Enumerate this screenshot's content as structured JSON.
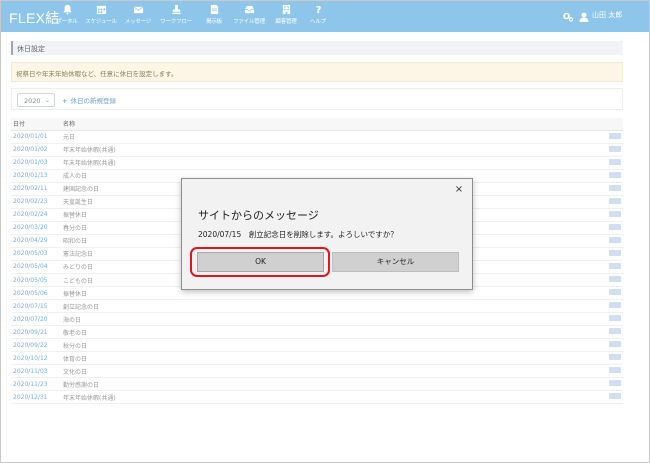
{
  "app": {
    "logo": "FLEX結",
    "colors": {
      "topbar": "#8ec5ea",
      "link": "#72aee3",
      "highlight": "#e0161c"
    }
  },
  "nav": [
    {
      "label": "ポータル",
      "icon": "bell-icon"
    },
    {
      "label": "スケジュール",
      "icon": "calendar-icon"
    },
    {
      "label": "メッセージ",
      "icon": "envelope-icon"
    },
    {
      "label": "ワークフロー",
      "icon": "stamp-icon"
    },
    {
      "label": "掲示板",
      "icon": "board-icon"
    },
    {
      "label": "ファイル管理",
      "icon": "inbox-icon"
    },
    {
      "label": "顧客管理",
      "icon": "building-icon"
    },
    {
      "label": "ヘルプ",
      "icon": "question-icon"
    }
  ],
  "header": {
    "user_name": "山田 太郎"
  },
  "page": {
    "title": "休日設定",
    "notice": "祝祭日や年末年始休暇など、任意に休日を設定します。",
    "year": "2020",
    "add_label": "休日の新規登録"
  },
  "table": {
    "columns": [
      "日付",
      "名称"
    ],
    "rows": [
      {
        "date": "2020/01/01",
        "name": "元日"
      },
      {
        "date": "2020/01/02",
        "name": "年末年始休暇(共通)"
      },
      {
        "date": "2020/01/03",
        "name": "年末年始休暇(共通)"
      },
      {
        "date": "2020/01/13",
        "name": "成人の日"
      },
      {
        "date": "2020/02/11",
        "name": "建国記念の日"
      },
      {
        "date": "2020/02/23",
        "name": "天皇誕生日"
      },
      {
        "date": "2020/02/24",
        "name": "振替休日"
      },
      {
        "date": "2020/03/20",
        "name": "春分の日"
      },
      {
        "date": "2020/04/29",
        "name": "昭和の日"
      },
      {
        "date": "2020/05/03",
        "name": "憲法記念日"
      },
      {
        "date": "2020/05/04",
        "name": "みどりの日"
      },
      {
        "date": "2020/05/05",
        "name": "こどもの日"
      },
      {
        "date": "2020/05/06",
        "name": "振替休日"
      },
      {
        "date": "2020/07/15",
        "name": "創立記念の日"
      },
      {
        "date": "2020/07/20",
        "name": "海の日"
      },
      {
        "date": "2020/09/21",
        "name": "敬老の日"
      },
      {
        "date": "2020/09/22",
        "name": "秋分の日"
      },
      {
        "date": "2020/10/12",
        "name": "体育の日"
      },
      {
        "date": "2020/11/03",
        "name": "文化の日"
      },
      {
        "date": "2020/11/23",
        "name": "勤労感謝の日"
      },
      {
        "date": "2020/12/31",
        "name": "年末年始休暇(共通)"
      }
    ]
  },
  "dialog": {
    "title": "サイトからのメッセージ",
    "message": "2020/07/15　創立記念日を削除します。よろしいですか？",
    "ok_label": "OK",
    "cancel_label": "キャンセル",
    "close_label": "×"
  }
}
